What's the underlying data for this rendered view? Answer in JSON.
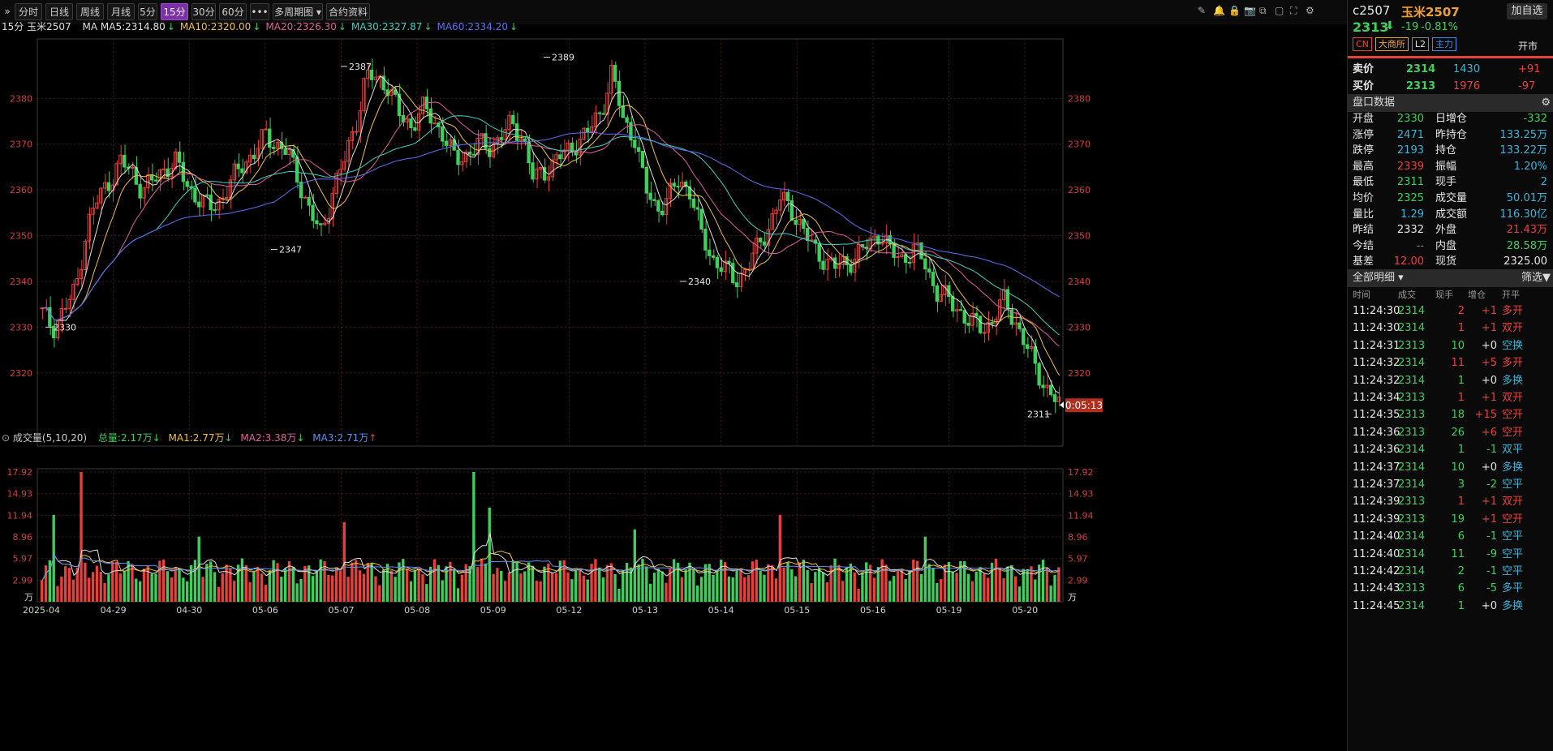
{
  "toolbar": {
    "expand_icon": "double-chevron-right-icon",
    "buttons": [
      "分时",
      "日线",
      "周线",
      "月线",
      "5分",
      "15分",
      "30分",
      "60分",
      "•••",
      "多周期图 ▾",
      "合约资料"
    ],
    "active": "15分",
    "right_icons": [
      "edit-icon",
      "bell-icon",
      "lock-icon",
      "camera-icon",
      "copy-icon",
      "window-icon",
      "fullscreen-icon",
      "settings-icon"
    ]
  },
  "ma_bar": {
    "period": "15分",
    "name": "玉米2507",
    "ma_prefix": "MA",
    "items": [
      {
        "text": "MA5:2314.80",
        "arrow": "↓",
        "color": "#e0e0e0"
      },
      {
        "text": "MA10:2320.00",
        "arrow": "↓",
        "color": "#f0c040"
      },
      {
        "text": "MA20:2326.30",
        "arrow": "↓",
        "color": "#e060a0"
      },
      {
        "text": "MA30:2327.87",
        "arrow": "↓",
        "color": "#40d0c0"
      },
      {
        "text": "MA60:2334.20",
        "arrow": "↓",
        "color": "#6070f0"
      }
    ]
  },
  "price_chart": {
    "y_ticks": [
      "2380",
      "2370",
      "2360",
      "2350",
      "2340",
      "2330",
      "2320"
    ],
    "annotations": [
      {
        "label": "2330",
        "kind": "low"
      },
      {
        "label": "2347",
        "kind": "low"
      },
      {
        "label": "2387",
        "kind": "high"
      },
      {
        "label": "2389",
        "kind": "high"
      },
      {
        "label": "2340",
        "kind": "low"
      },
      {
        "label": "2311",
        "kind": "low"
      }
    ],
    "countdown": "0:05:13"
  },
  "volume_chart": {
    "title": "成交量(5,10,20)",
    "total": "总量:2.17万",
    "ma1": "MA1:2.77万",
    "ma2": "MA2:3.38万",
    "ma3": "MA3:2.71万",
    "y_ticks": [
      "17.92",
      "14.93",
      "11.94",
      "8.96",
      "5.97",
      "2.99"
    ],
    "unit": "万"
  },
  "x_dates": [
    "2025-04",
    "04-29",
    "04-30",
    "05-06",
    "05-07",
    "05-08",
    "05-09",
    "05-12",
    "05-13",
    "05-14",
    "05-15",
    "05-16",
    "05-19",
    "05-20"
  ],
  "chart_data": {
    "type": "candlestick",
    "symbol": "c2507",
    "name": "玉米2507",
    "interval": "15分",
    "ylim": [
      2311,
      2389
    ],
    "close_series": [
      2333,
      2330,
      2334,
      2338,
      2352,
      2358,
      2362,
      2366,
      2364,
      2360,
      2362,
      2365,
      2366,
      2361,
      2358,
      2356,
      2358,
      2362,
      2366,
      2368,
      2372,
      2370,
      2368,
      2362,
      2355,
      2350,
      2360,
      2366,
      2374,
      2385,
      2384,
      2383,
      2376,
      2374,
      2378,
      2375,
      2372,
      2366,
      2368,
      2370,
      2369,
      2372,
      2374,
      2372,
      2362,
      2364,
      2367,
      2368,
      2371,
      2373,
      2377,
      2386,
      2375,
      2372,
      2360,
      2356,
      2358,
      2362,
      2360,
      2350,
      2345,
      2343,
      2340,
      2343,
      2347,
      2352,
      2358,
      2356,
      2352,
      2347,
      2345,
      2343,
      2344,
      2346,
      2348,
      2351,
      2346,
      2345,
      2347,
      2344,
      2338,
      2336,
      2334,
      2331,
      2330,
      2331,
      2336,
      2332,
      2326,
      2321,
      2316,
      2313
    ],
    "volume_peak": 17.92,
    "volume_unit": "万",
    "last_volume_total": 2.17
  },
  "side": {
    "code": "c2507",
    "name": "玉米2507",
    "add_button": "加自选",
    "price": "2313",
    "change": "-19",
    "change_pct": "-0.81%",
    "tags": [
      "CN",
      "大商所",
      "L2",
      "主力"
    ],
    "status": "开市",
    "ask": {
      "label": "卖价",
      "price": "2314",
      "vol": "1430",
      "delta": "+91"
    },
    "bid": {
      "label": "买价",
      "price": "2313",
      "vol": "1976",
      "delta": "-97"
    },
    "quote_title": "盘口数据",
    "quote": [
      {
        "l1": "开盘",
        "v1": "2330",
        "l2": "日增仓",
        "v2": "-332",
        "c1": "green",
        "c2": "green"
      },
      {
        "l1": "涨停",
        "v1": "2471",
        "l2": "昨持仓",
        "v2": "133.25万",
        "c1": "cyan",
        "c2": "cyan"
      },
      {
        "l1": "跌停",
        "v1": "2193",
        "l2": "持仓",
        "v2": "133.22万",
        "c1": "cyan",
        "c2": "cyan"
      },
      {
        "l1": "最高",
        "v1": "2339",
        "l2": "振幅",
        "v2": "1.20%",
        "c1": "red",
        "c2": "cyan"
      },
      {
        "l1": "最低",
        "v1": "2311",
        "l2": "现手",
        "v2": "2",
        "c1": "green",
        "c2": "cyan"
      },
      {
        "l1": "均价",
        "v1": "2325",
        "l2": "成交量",
        "v2": "50.01万",
        "c1": "green",
        "c2": "cyan"
      },
      {
        "l1": "量比",
        "v1": "1.29",
        "l2": "成交额",
        "v2": "116.30亿",
        "c1": "cyan",
        "c2": "cyan"
      },
      {
        "l1": "昨结",
        "v1": "2332",
        "l2": "外盘",
        "v2": "21.43万",
        "c1": "white",
        "c2": "red"
      },
      {
        "l1": "今结",
        "v1": "--",
        "l2": "内盘",
        "v2": "28.58万",
        "c1": "gray",
        "c2": "green"
      },
      {
        "l1": "基差",
        "v1": "12.00",
        "l2": "现货",
        "v2": "2325.00",
        "c1": "red",
        "c2": "white"
      }
    ],
    "detail_title": "全部明细 ▾",
    "filter_label": "筛选",
    "detail_headers": [
      "时间",
      "成交",
      "现手",
      "增仓",
      "开平"
    ],
    "trades": [
      {
        "t": "11:24:30",
        "p": "2314",
        "v": "2",
        "d": "+1",
        "k": "多开"
      },
      {
        "t": "11:24:30",
        "p": "2314",
        "v": "1",
        "d": "+1",
        "k": "双开"
      },
      {
        "t": "11:24:31",
        "p": "2313",
        "v": "10",
        "d": "+0",
        "k": "空换"
      },
      {
        "t": "11:24:32",
        "p": "2314",
        "v": "11",
        "d": "+5",
        "k": "多开"
      },
      {
        "t": "11:24:32",
        "p": "2314",
        "v": "1",
        "d": "+0",
        "k": "多换"
      },
      {
        "t": "11:24:34",
        "p": "2313",
        "v": "1",
        "d": "+1",
        "k": "双开"
      },
      {
        "t": "11:24:35",
        "p": "2313",
        "v": "18",
        "d": "+15",
        "k": "空开"
      },
      {
        "t": "11:24:36",
        "p": "2313",
        "v": "26",
        "d": "+6",
        "k": "空开"
      },
      {
        "t": "11:24:36",
        "p": "2314",
        "v": "1",
        "d": "-1",
        "k": "双平"
      },
      {
        "t": "11:24:37",
        "p": "2314",
        "v": "10",
        "d": "+0",
        "k": "多换"
      },
      {
        "t": "11:24:37",
        "p": "2314",
        "v": "3",
        "d": "-2",
        "k": "空平"
      },
      {
        "t": "11:24:39",
        "p": "2313",
        "v": "1",
        "d": "+1",
        "k": "双开"
      },
      {
        "t": "11:24:39",
        "p": "2313",
        "v": "19",
        "d": "+1",
        "k": "空开"
      },
      {
        "t": "11:24:40",
        "p": "2314",
        "v": "6",
        "d": "-1",
        "k": "空平"
      },
      {
        "t": "11:24:40",
        "p": "2314",
        "v": "11",
        "d": "-9",
        "k": "空平"
      },
      {
        "t": "11:24:42",
        "p": "2314",
        "v": "2",
        "d": "-1",
        "k": "空平"
      },
      {
        "t": "11:24:43",
        "p": "2313",
        "v": "6",
        "d": "-5",
        "k": "多平"
      },
      {
        "t": "11:24:45",
        "p": "2314",
        "v": "1",
        "d": "+0",
        "k": "多换"
      }
    ]
  },
  "colors": {
    "up": "#e8413c",
    "down": "#3ecf5c",
    "bg": "#000000",
    "grid": "#3a1414"
  }
}
